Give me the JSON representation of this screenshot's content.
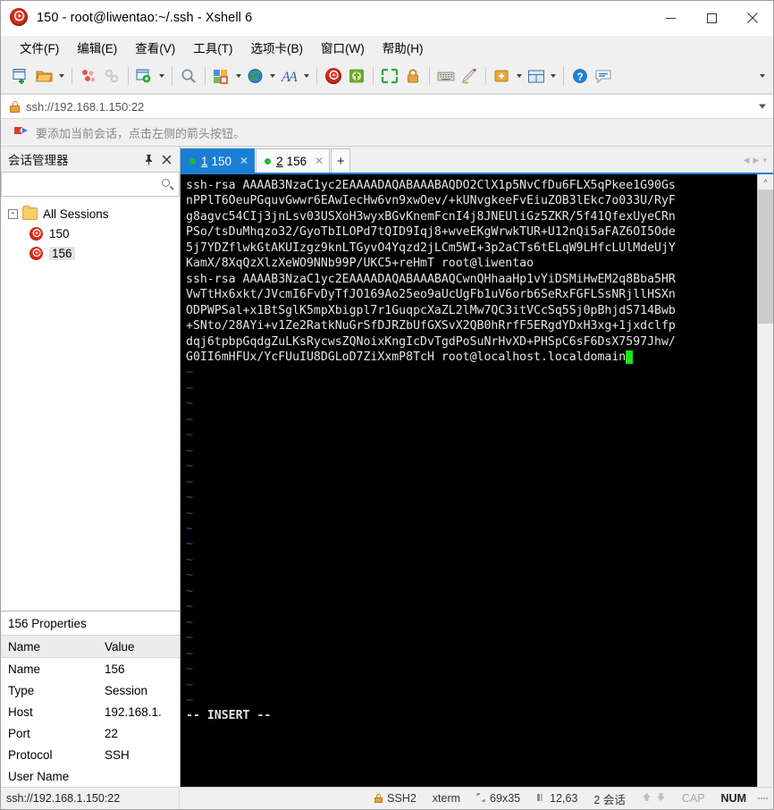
{
  "window": {
    "title": "150 - root@liwentao:~/.ssh - Xshell 6",
    "app_icon": "xshell-swirl-icon",
    "minimize_label": "Minimize",
    "maximize_label": "Maximize",
    "close_label": "Close"
  },
  "menu": {
    "items": [
      {
        "label": "文件(F)",
        "name": "menu-file"
      },
      {
        "label": "编辑(E)",
        "name": "menu-edit"
      },
      {
        "label": "查看(V)",
        "name": "menu-view"
      },
      {
        "label": "工具(T)",
        "name": "menu-tools"
      },
      {
        "label": "选项卡(B)",
        "name": "menu-tab"
      },
      {
        "label": "窗口(W)",
        "name": "menu-window"
      },
      {
        "label": "帮助(H)",
        "name": "menu-help"
      }
    ]
  },
  "toolbar": {
    "overflow_label": "More toolbar buttons",
    "buttons": [
      {
        "icon": "new-file-icon",
        "dropdown": false
      },
      {
        "icon": "open-folder-icon",
        "dropdown": true
      },
      {
        "icon": "session-manager-icon",
        "dropdown": false
      },
      {
        "icon": "link-chain-icon",
        "dropdown": false
      },
      {
        "icon": "session-properties-icon",
        "dropdown": true
      },
      {
        "icon": "find-icon",
        "dropdown": false
      },
      {
        "icon": "file-transfer-icon",
        "dropdown": true
      },
      {
        "icon": "globe-icon",
        "dropdown": true
      },
      {
        "icon": "font-icon",
        "dropdown": true
      },
      {
        "icon": "xshell-swirl-icon",
        "dropdown": false
      },
      {
        "icon": "xftp-icon",
        "dropdown": false
      },
      {
        "icon": "fullscreen-icon",
        "dropdown": false
      },
      {
        "icon": "lock-icon",
        "dropdown": false
      },
      {
        "icon": "keyboard-icon",
        "dropdown": false
      },
      {
        "icon": "highlight-pen-icon",
        "dropdown": false
      },
      {
        "icon": "add-session-icon",
        "dropdown": true
      },
      {
        "icon": "layout-icon",
        "dropdown": true
      },
      {
        "icon": "help-icon",
        "dropdown": false
      },
      {
        "icon": "chat-icon",
        "dropdown": false
      }
    ]
  },
  "address_bar": {
    "icon": "lock-icon",
    "value": "ssh://192.168.1.150:22",
    "placeholder": "ssh://",
    "dropdown_label": "History"
  },
  "notice": {
    "icon": "red-flag-icon",
    "text": "要添加当前会话，点击左侧的箭头按钮。"
  },
  "sidebar": {
    "title": "会话管理器",
    "pin_label": "Pin",
    "close_label": "Close",
    "search_placeholder": "",
    "search_icon": "search-icon",
    "tree": {
      "root_label": "All Sessions",
      "root_expander": "-",
      "items": [
        {
          "label": "150",
          "selected": false
        },
        {
          "label": "156",
          "selected": true
        }
      ]
    },
    "properties": {
      "title": "156 Properties",
      "headers": [
        "Name",
        "Value"
      ],
      "rows": [
        {
          "name": "Name",
          "value": "156"
        },
        {
          "name": "Type",
          "value": "Session"
        },
        {
          "name": "Host",
          "value": "192.168.1."
        },
        {
          "name": "Port",
          "value": "22"
        },
        {
          "name": "Protocol",
          "value": "SSH"
        },
        {
          "name": "User Name",
          "value": ""
        }
      ]
    }
  },
  "tabs": {
    "items": [
      {
        "index": "1",
        "label": "150",
        "active": true,
        "status": "connected"
      },
      {
        "index": "2",
        "label": "156",
        "active": false,
        "status": "connected"
      }
    ],
    "new_tab_label": "+",
    "nav_prev": "◀",
    "nav_next": "▶",
    "nav_list": "▾"
  },
  "terminal": {
    "lines": [
      "ssh-rsa AAAAB3NzaC1yc2EAAAADAQABAAABAQDO2ClX1p5NvCfDu6FLX5qPkee1G90Gs",
      "nPPlT6OeuPGquvGwwr6EAwIecHw6vn9xwOev/+kUNvgkeeFvEiuZOB3lEkc7o033U/RyF",
      "g8agvc54CIj3jnLsv03USXoH3wyxBGvKnemFcnI4j8JNEUliGz5ZKR/5f41QfexUyeCRn",
      "PSo/tsDuMhqzo32/GyoTbILOPd7tQID9Iqj8+wveEKgWrwkTUR+U12nQi5aFAZ6OI5Ode",
      "5j7YDZflwkGtAKUIzgz9knLTGyvO4Yqzd2jLCm5WI+3p2aCTs6tELqW9LHfcLUlMdeUjY",
      "KamX/8XqQzXlzXeWO9NNb99P/UKC5+reHmT root@liwentao",
      "ssh-rsa AAAAB3NzaC1yc2EAAAADAQABAAABAQCwnQHhaaHp1vYiDSMiHwEM2q8Bba5HR",
      "VwTtHx6xkt/JVcmI6FvDyTfJO169Ao25eo9aUcUgFb1uV6orb6SeRxFGFLSsNRjllHSXn",
      "ODPWPSal+x1BtSglK5mpXbigpl7r1GuqpcXaZL2lMw7QC3itVCcSq5Sj0pBhjdS714Bwb",
      "+SNto/28AYi+v1Ze2RatkNuGrSfDJRZbUfGXSvX2QB0hRrfF5ERgdYDxH3xg+1jxdclfp",
      "dqj6tpbpGqdgZuLKsRycwsZQNoixKngIcDvTgdPoSuNrHvXD+PHSpC6sF6DsX7597Jhw/",
      "G0II6mHFUx/YcFUuIU8DGLoD7ZiXxmP8TcH root@localhost.localdomain"
    ],
    "cursor_after_line": 11,
    "tilde_count": 22,
    "mode_line": "-- INSERT --",
    "scroll_up_label": "^",
    "scroll_down_label": "v"
  },
  "status_bar": {
    "connection": "ssh://192.168.1.150:22",
    "protocol_icon": "lock-icon",
    "protocol": "SSH2",
    "terminal_type": "xterm",
    "size_icon": "screen-size-icon",
    "size": "69x35",
    "cursor_icon": "cursor-position-icon",
    "cursor": "12,63",
    "sessions": "2 会话",
    "upload_icon": "upload-arrow-icon",
    "download_icon": "download-arrow-icon",
    "cap": "CAP",
    "num": "NUM",
    "grip": "resize-grip"
  },
  "colors": {
    "accent": "#1a7fd4",
    "terminal_bg": "#000000",
    "terminal_fg": "#e6e6e6",
    "tilde": "#2d4ea8",
    "cursor": "#19e519",
    "status_green": "#22bb33",
    "chrome": "#f0f0f0"
  }
}
